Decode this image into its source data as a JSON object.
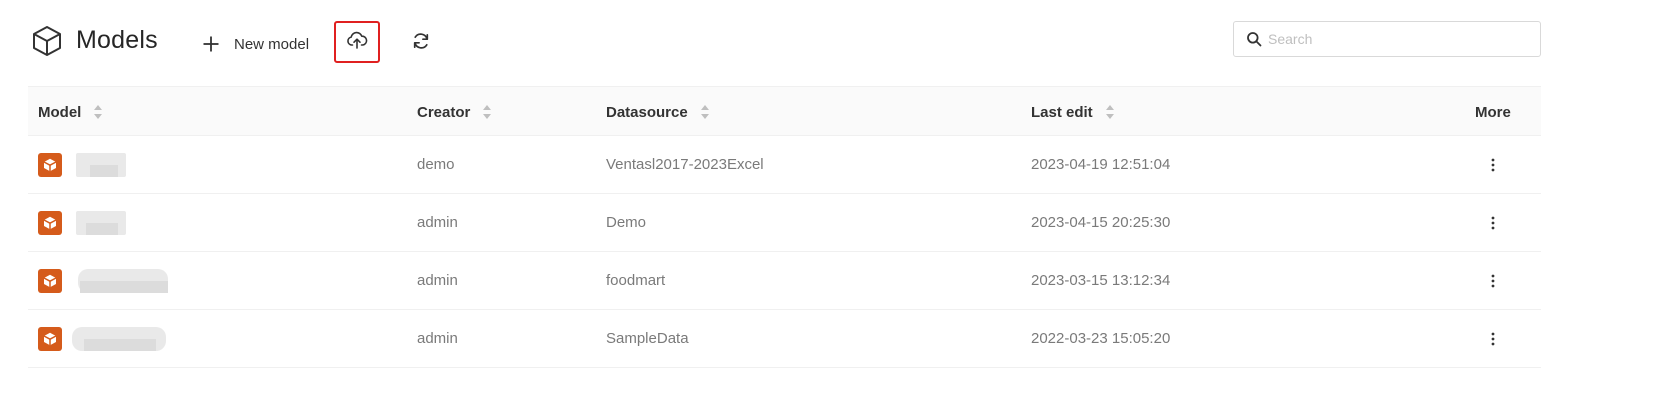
{
  "header": {
    "title": "Models",
    "title_icon": "cube-outline-icon",
    "new_model_label": "New model",
    "new_model_icon": "plus-icon",
    "upload_icon": "cloud-upload-icon",
    "refresh_icon": "refresh-icon",
    "search_placeholder": "Search",
    "search_value": "",
    "highlight_color": "#e02020"
  },
  "table": {
    "columns": [
      {
        "label": "Model",
        "sortable": true
      },
      {
        "label": "Creator",
        "sortable": true
      },
      {
        "label": "Datasource",
        "sortable": true
      },
      {
        "label": "Last edit",
        "sortable": true
      },
      {
        "label": "More",
        "sortable": false
      }
    ],
    "rows": [
      {
        "model_name": "",
        "model_name_redacted": true,
        "creator": "demo",
        "datasource": "Ventasl2017-2023Excel",
        "last_edit": "2023-04-19 12:51:04"
      },
      {
        "model_name": "",
        "model_name_redacted": true,
        "creator": "admin",
        "datasource": "Demo",
        "last_edit": "2023-04-15 20:25:30"
      },
      {
        "model_name": "",
        "model_name_redacted": true,
        "creator": "admin",
        "datasource": "foodmart",
        "last_edit": "2023-03-15 13:12:34"
      },
      {
        "model_name": "",
        "model_name_redacted": true,
        "creator": "admin",
        "datasource": "SampleData",
        "last_edit": "2022-03-23 15:05:20"
      }
    ],
    "row_icon": "model-cube-icon",
    "row_icon_color": "#d55b1b",
    "more_icon": "more-vertical-icon"
  }
}
